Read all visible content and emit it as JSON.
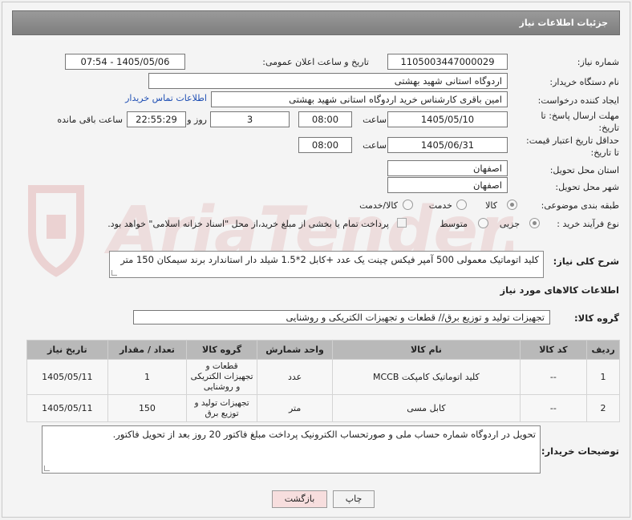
{
  "title": "جزئیات اطلاعات نیاز",
  "labels": {
    "need_number": "شماره نیاز:",
    "announce_datetime": "تاریخ و ساعت اعلان عمومی:",
    "buyer_org": "نام دستگاه خریدار:",
    "creator": "ایجاد کننده درخواست:",
    "reply_deadline": "مهلت ارسال پاسخ: تا تاریخ:",
    "hour": "ساعت",
    "day_and": "روز و",
    "remaining": "ساعت باقی مانده",
    "price_validity": "حداقل تاریخ اعتبار قیمت: تا تاریخ:",
    "province": "استان محل تحویل:",
    "city": "شهر محل تحویل:",
    "category": "طبقه بندی موضوعی:",
    "process_type": "نوع فرآیند خرید :",
    "description": "شرح کلی نیاز:",
    "goods_info": "اطلاعات کالاهای مورد نیاز",
    "goods_group": "گروه کالا:",
    "buyer_notes": "توضیحات خریدار:"
  },
  "values": {
    "need_number": "1105003447000029",
    "announce_datetime": "1405/05/06 - 07:54",
    "buyer_org": "اردوگاه استانی شهید بهشتی",
    "creator": "امین باقری کارشناس خرید اردوگاه استانی شهید بهشتی",
    "contact_link": "اطلاعات تماس خریدار",
    "reply_date": "1405/05/10",
    "reply_time": "08:00",
    "days": "3",
    "remaining_time": "22:55:29",
    "validity_date": "1405/06/31",
    "validity_time": "08:00",
    "province": "اصفهان",
    "city": "اصفهان",
    "description": "کلید اتوماتیک معمولی 500 آمپر فیکس چینت یک عدد  +کابل 2*1.5 شیلد دار استاندارد برند سیمکان 150 متر",
    "goods_group": "تجهیزات تولید و توزیع برق// قطعات و تجهیزات الکتریکی و روشنایی",
    "buyer_notes": "تحویل در اردوگاه شماره حساب ملی و صورتحساب الکترونیک پرداخت مبلغ فاکتور 20 روز بعد از تحویل فاکتور."
  },
  "category_options": {
    "goods": "کالا",
    "service": "خدمت",
    "goods_service": "کالا/خدمت",
    "selected": "کالا"
  },
  "process_options": {
    "partial": "جزیی",
    "medium": "متوسط",
    "selected": "جزیی",
    "treasury_note": "پرداخت تمام یا بخشی از مبلغ خرید،از محل \"اسناد خزانه اسلامی\" خواهد بود."
  },
  "table": {
    "headers": [
      "ردیف",
      "کد کالا",
      "نام کالا",
      "واحد شمارش",
      "گروه کالا",
      "تعداد / مقدار",
      "تاریخ نیاز"
    ],
    "rows": [
      [
        "1",
        "--",
        "کلید اتوماتیک کامپکت MCCB",
        "عدد",
        "قطعات و تجهیزات الکتریکی و روشنایی",
        "1",
        "1405/05/11"
      ],
      [
        "2",
        "--",
        "کابل مسی",
        "متر",
        "تجهیزات تولید و توزیع برق",
        "150",
        "1405/05/11"
      ]
    ]
  },
  "buttons": {
    "print": "چاپ",
    "back": "بازگشت"
  },
  "watermark_text": "AriaTender.net",
  "colors": {
    "titlebar": "#8a8a8a",
    "link": "#1f4fb4",
    "table_header": "#b9b9b9",
    "back_button": "#f7dede",
    "watermark": "#e8c9c9"
  }
}
